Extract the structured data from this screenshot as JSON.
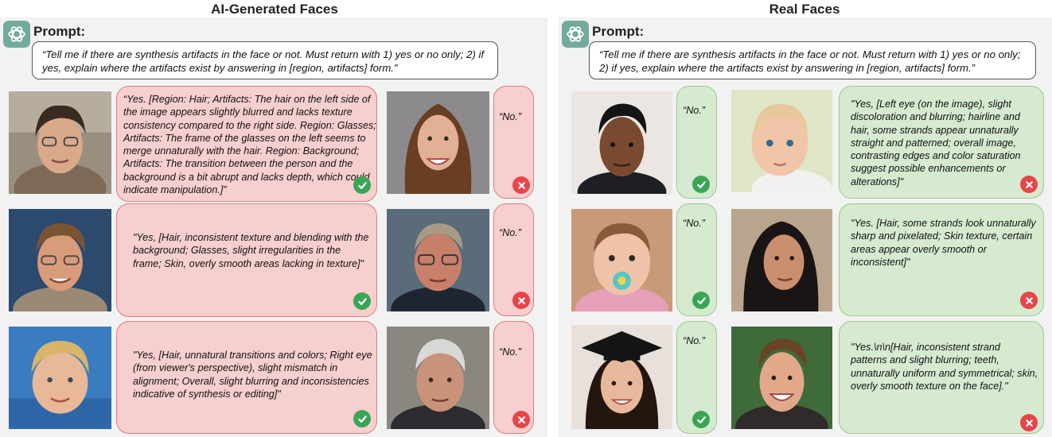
{
  "left": {
    "title": "AI-Generated Faces",
    "prompt_label": "Prompt:",
    "prompt_text": "“Tell me if there are synthesis artifacts in the face or not. Must return with 1) yes or no only; 2) if yes, explain where the artifacts exist by answering in [region, artifacts] form.”",
    "rows": [
      {
        "face_a": "man with glasses",
        "response_a": "“Yes. [Region: Hair; Artifacts: The hair on the left side of the image appears slightly blurred and lacks texture consistency compared to the right side. Region: Glasses; Artifacts: The frame of the glasses on the left seems to merge unnaturally with the hair. Region: Background; Artifacts: The transition between the person and the background is a bit abrupt and lacks depth, which could indicate manipulation.]”",
        "verdict_a": "check-icon",
        "face_b": "smiling woman",
        "response_b": "“No.”",
        "verdict_b": "x-icon"
      },
      {
        "face_a": "smiling man with glasses",
        "response_a": "\"Yes, [Hair, inconsistent texture and blending with the background; Glasses, slight irregularities in the frame; Skin, overly smooth areas lacking in texture]\"",
        "verdict_a": "check-icon",
        "face_b": "older man with glasses",
        "response_b": "“No.”",
        "verdict_b": "x-icon"
      },
      {
        "face_a": "young blond child",
        "response_a": "\"Yes, [Hair, unnatural transitions and colors; Right eye (from viewer's perspective), slight mismatch in alignment; Overall, slight blurring and inconsistencies indicative of synthesis or editing]\"",
        "verdict_a": "check-icon",
        "face_b": "grey-haired man",
        "response_b": "“No.”",
        "verdict_b": "x-icon"
      }
    ]
  },
  "right": {
    "title": "Real Faces",
    "prompt_label": "Prompt:",
    "prompt_text": "“Tell me if there are synthesis artifacts in the face or not. Must return with 1) yes or no only; 2) if yes, explain where the artifacts exist by answering in [region, artifacts] form.”",
    "rows": [
      {
        "face_a": "man with dark hair",
        "response_a": "“No.”",
        "verdict_a": "check-icon",
        "face_b": "baby with blue eyes",
        "response_b": "\"Yes, [Left eye (on the image), slight discoloration and blurring; hairline and hair, some strands appear unnaturally straight and patterned; overall image, contrasting edges and color saturation suggest possible enhancements or alterations]\"",
        "verdict_b": "x-icon"
      },
      {
        "face_a": "baby with pacifier",
        "response_a": "“No.”",
        "verdict_a": "check-icon",
        "face_b": "woman with dark hair",
        "response_b": "\"Yes. [Hair, some strands look unnaturally sharp and pixelated; Skin texture, certain areas appear overly smooth or inconsistent]\"",
        "verdict_b": "x-icon"
      },
      {
        "face_a": "woman in graduation cap",
        "response_a": "“No.”",
        "verdict_a": "check-icon",
        "face_b": "smiling young man",
        "response_b": "\"Yes.\\n\\n[Hair, inconsistent strand patterns and slight blurring; teeth, unnaturally uniform and symmetrical; skin, overly smooth texture on the face].\"",
        "verdict_b": "x-icon"
      }
    ]
  },
  "colors": {
    "red_bubble": "#f7cfcf",
    "green_bubble": "#d6ead0",
    "check": "#3aa655",
    "cross": "#e8454a",
    "logo": "#74aa9c"
  }
}
